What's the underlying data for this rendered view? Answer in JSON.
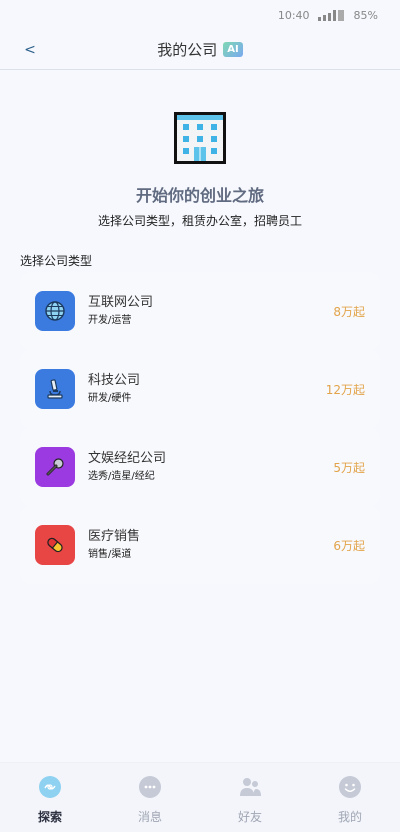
{
  "status_bar": {
    "time": "10:40",
    "battery": "85%"
  },
  "header": {
    "back_label": "<",
    "title": "我的公司",
    "badge": "AI"
  },
  "hero": {
    "icon": "office-building-icon",
    "title": "开始你的创业之旅",
    "subtitle": "选择公司类型，租赁办公室，招聘员工"
  },
  "section_label": "选择公司类型",
  "companies": [
    {
      "name": "互联网公司",
      "desc": "开发/运营",
      "price": "8万起",
      "icon": "globe-icon",
      "color": "#3b7be0"
    },
    {
      "name": "科技公司",
      "desc": "研发/硬件",
      "price": "12万起",
      "icon": "microscope-icon",
      "color": "#3b7be0"
    },
    {
      "name": "文娱经纪公司",
      "desc": "选秀/造星/经纪",
      "price": "5万起",
      "icon": "microphone-icon",
      "color": "#9a3ae0"
    },
    {
      "name": "医疗销售",
      "desc": "销售/渠道",
      "price": "6万起",
      "icon": "pill-icon",
      "color": "#e84545"
    }
  ],
  "tabs": [
    {
      "label": "探索",
      "icon": "explore-icon",
      "active": true
    },
    {
      "label": "消息",
      "icon": "message-icon",
      "active": false
    },
    {
      "label": "好友",
      "icon": "friends-icon",
      "active": false
    },
    {
      "label": "我的",
      "icon": "profile-icon",
      "active": false
    }
  ],
  "colors": {
    "accent_price": "#e2a44a",
    "blue": "#3b7be0",
    "purple": "#9a3ae0",
    "red": "#e84545"
  }
}
